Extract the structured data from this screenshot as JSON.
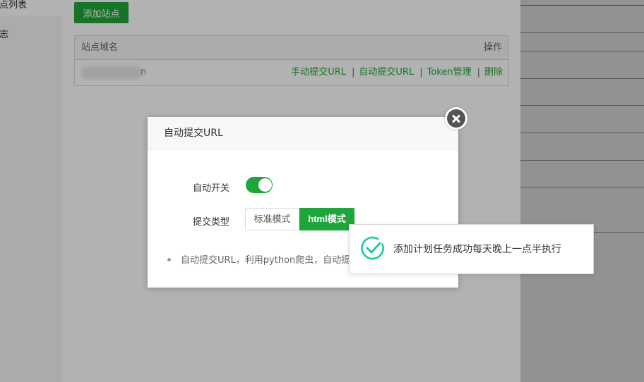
{
  "sidebar": {
    "items": [
      {
        "label": "站点列表"
      },
      {
        "label": "日志"
      }
    ]
  },
  "toolbar": {
    "add_site_label": "添加站点"
  },
  "table": {
    "headers": {
      "domain": "站点域名",
      "actions": "操作"
    },
    "rows": [
      {
        "domain_suffix": "n",
        "actions": [
          {
            "label": "手动提交URL"
          },
          {
            "label": "自动提交URL"
          },
          {
            "label": "Token管理"
          },
          {
            "label": "删除"
          }
        ],
        "separator": "|"
      }
    ]
  },
  "dialog": {
    "title": "自动提交URL",
    "switch_label": "自动开关",
    "switch_on": true,
    "type_label": "提交类型",
    "modes": [
      {
        "label": "标准模式",
        "active": false
      },
      {
        "label": "html模式",
        "active": true
      }
    ],
    "tip": "自动提交URL，利用python爬虫，自动提"
  },
  "toast": {
    "message": "添加计划任务成功每天晚上一点半执行",
    "icon": "check-circle-icon"
  },
  "colors": {
    "accent": "#20a53a",
    "toast_icon": "#1fc8a0"
  }
}
